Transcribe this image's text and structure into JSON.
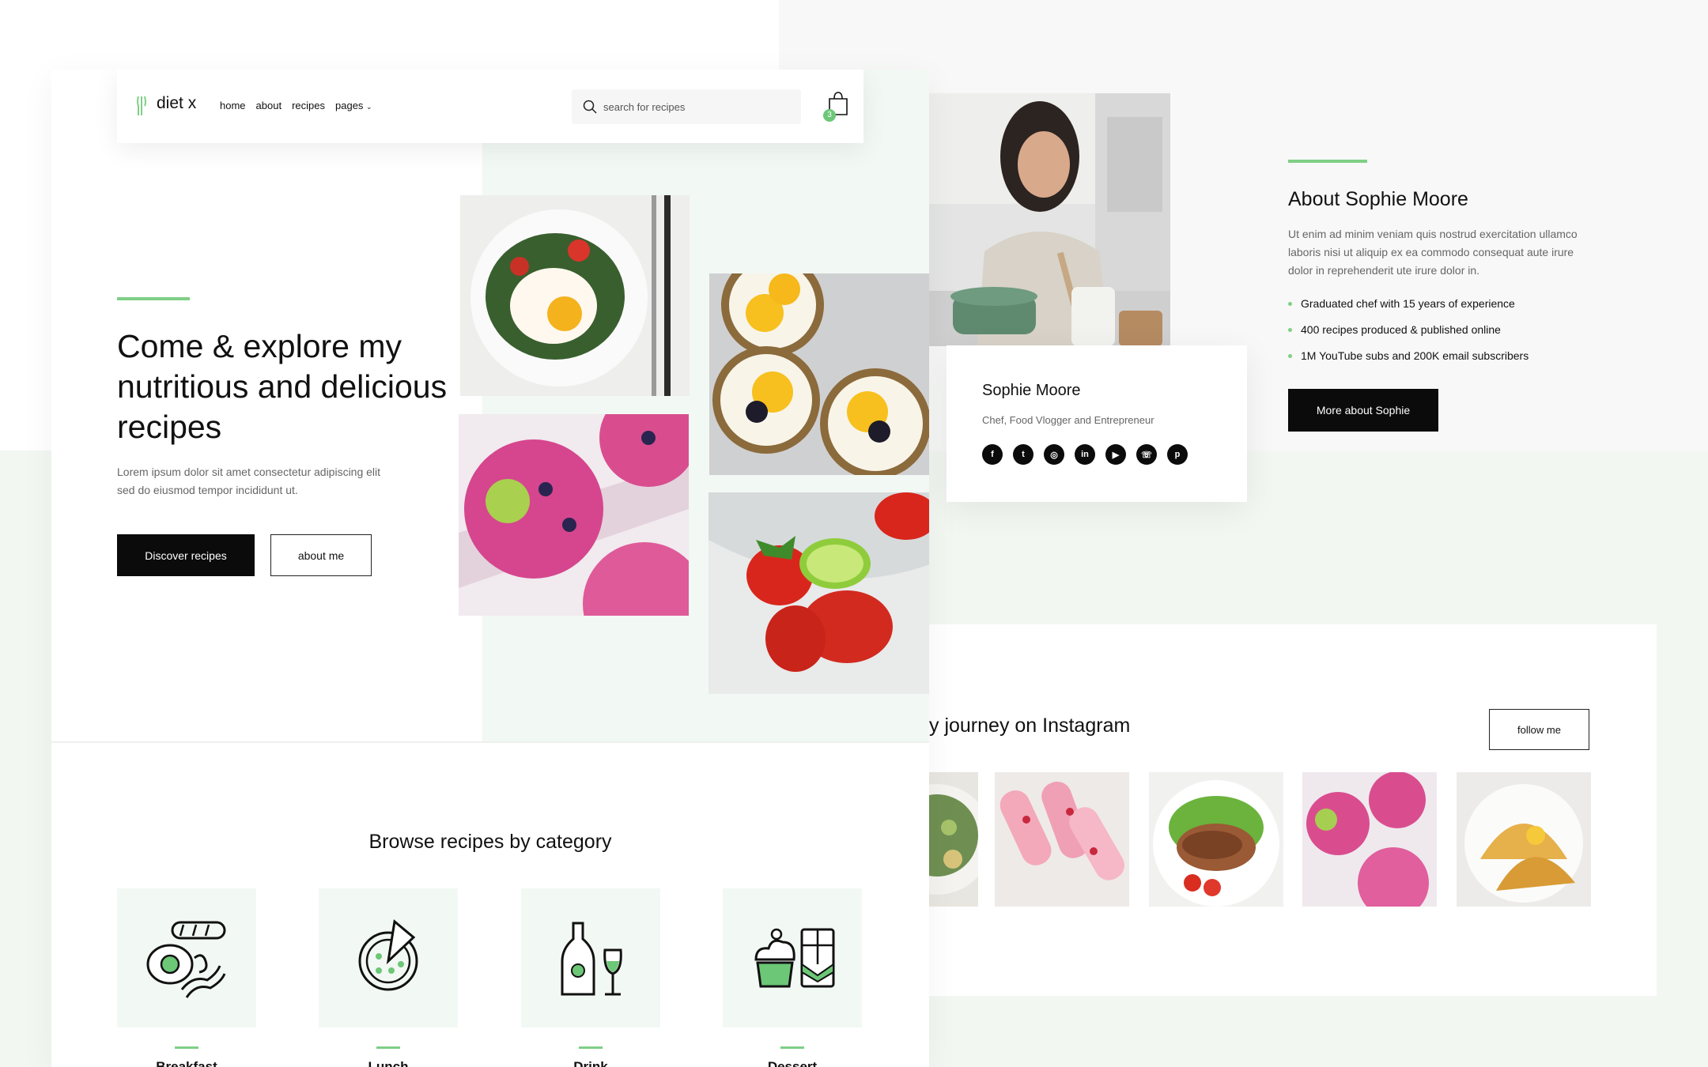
{
  "colors": {
    "accent": "#7fcf86",
    "dark": "#0b0b0b",
    "soft_green": "#f2f8f3"
  },
  "nav": {
    "logo": "diet x",
    "links": [
      "home",
      "about",
      "recipes",
      "pages"
    ],
    "search_placeholder": "search for recipes",
    "cart_count": "3"
  },
  "hero": {
    "title": "Come & explore my nutritious and delicious recipes",
    "description": "Lorem ipsum dolor sit amet consectetur adipiscing elit sed do eiusmod tempor incididunt ut.",
    "primary_button": "Discover recipes",
    "secondary_button": "about me"
  },
  "categories": {
    "title": "Browse recipes by category",
    "items": [
      {
        "label": "Breakfast",
        "icon": "breakfast-icon"
      },
      {
        "label": "Lunch",
        "icon": "pizza-icon"
      },
      {
        "label": "Drink",
        "icon": "drink-icon"
      },
      {
        "label": "Dessert",
        "icon": "dessert-icon"
      }
    ]
  },
  "profile": {
    "name": "Sophie Moore",
    "role": "Chef, Food Vlogger and Entrepreneur",
    "socials": [
      "facebook-icon",
      "twitter-icon",
      "instagram-icon",
      "linkedin-icon",
      "youtube-icon",
      "whatsapp-icon",
      "pinterest-icon"
    ]
  },
  "about": {
    "title": "About Sophie Moore",
    "text": "Ut enim ad minim veniam quis nostrud exercitation ullamco laboris nisi ut aliquip ex ea commodo consequat aute irure dolor in reprehenderit ute irure dolor in.",
    "bullets": [
      "Graduated chef with 15 years of experience",
      "400 recipes produced & published online",
      "1M YouTube subs and 200K email subscribers"
    ],
    "button": "More about Sophie"
  },
  "instagram": {
    "title": "y journey on Instagram",
    "button": "follow me"
  }
}
